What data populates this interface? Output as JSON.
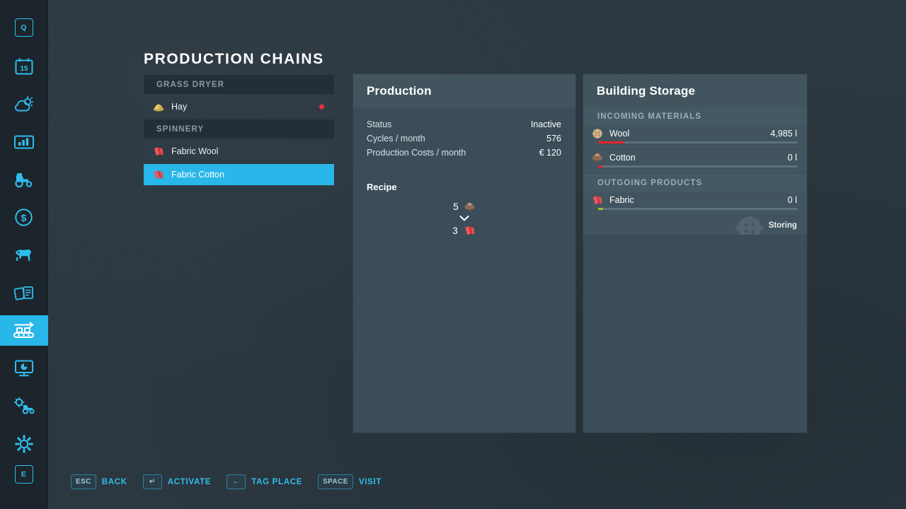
{
  "sidebar": {
    "items": [
      {
        "name": "sidebar-item-quick-menu",
        "icon": "key-q-icon",
        "key": "Q",
        "active": false
      },
      {
        "name": "sidebar-item-calendar",
        "icon": "calendar-15-icon",
        "key": "15",
        "active": false
      },
      {
        "name": "sidebar-item-weather",
        "icon": "weather-icon",
        "active": false
      },
      {
        "name": "sidebar-item-statistics",
        "icon": "chart-bar-icon",
        "active": false
      },
      {
        "name": "sidebar-item-vehicles",
        "icon": "tractor-icon",
        "active": false
      },
      {
        "name": "sidebar-item-finances",
        "icon": "dollar-circle-icon",
        "active": false
      },
      {
        "name": "sidebar-item-animals",
        "icon": "cow-icon",
        "active": false
      },
      {
        "name": "sidebar-item-contracts",
        "icon": "documents-icon",
        "active": false
      },
      {
        "name": "sidebar-item-production",
        "icon": "conveyor-belt-icon",
        "active": true
      },
      {
        "name": "sidebar-item-map-overview",
        "icon": "presentation-board-icon",
        "active": false
      },
      {
        "name": "sidebar-item-vehicle-config",
        "icon": "tractor-gear-icon",
        "active": false
      },
      {
        "name": "sidebar-item-settings",
        "icon": "gear-icon",
        "active": false
      },
      {
        "name": "sidebar-item-exit",
        "icon": "key-e-icon",
        "key": "E",
        "active": false
      }
    ]
  },
  "page_title": "PRODUCTION CHAINS",
  "chain_list": [
    {
      "type": "group",
      "label": "GRASS DRYER",
      "rows": [
        {
          "label": "Hay",
          "icon": "hay-pile-icon",
          "selected": false,
          "status_dot": "#e8323c"
        }
      ]
    },
    {
      "type": "group",
      "label": "SPINNERY",
      "rows": [
        {
          "label": "Fabric Wool",
          "icon": "fabric-bale-icon",
          "selected": false,
          "status_dot": null
        },
        {
          "label": "Fabric Cotton",
          "icon": "fabric-bale-icon",
          "selected": true,
          "status_dot": null
        }
      ]
    }
  ],
  "production": {
    "title": "Production",
    "stats": [
      {
        "label": "Status",
        "value": "Inactive"
      },
      {
        "label": "Cycles / month",
        "value": "576"
      },
      {
        "label": "Production Costs / month",
        "value": "€ 120"
      }
    ],
    "recipe_title": "Recipe",
    "recipe": {
      "input": {
        "amount": "5",
        "icon": "cotton-boll-icon"
      },
      "arrow": "chevron-down-icon",
      "output": {
        "amount": "3",
        "icon": "fabric-bale-icon"
      }
    }
  },
  "storage": {
    "title": "Building Storage",
    "sections": [
      {
        "label": "INCOMING MATERIALS",
        "items": [
          {
            "name": "Wool",
            "icon": "wool-ball-icon",
            "amount": "4,985 l",
            "fill_percent": 13,
            "fill_color": "#e8232d",
            "extra": null
          },
          {
            "name": "Cotton",
            "icon": "cotton-boll-icon",
            "amount": "0 l",
            "fill_percent": 2,
            "fill_color": "#e8232d",
            "extra": null
          }
        ]
      },
      {
        "label": "OUTGOING PRODUCTS",
        "items": [
          {
            "name": "Fabric",
            "icon": "fabric-bale-icon",
            "amount": "0 l",
            "fill_percent": 2,
            "fill_color": "#9ac42a",
            "extra": "Storing"
          }
        ]
      }
    ]
  },
  "help_bar": [
    {
      "key": "ESC",
      "label": "BACK"
    },
    {
      "key": "↵",
      "label": "ACTIVATE"
    },
    {
      "key": "←",
      "label": "TAG PLACE"
    },
    {
      "key": "SPACE",
      "label": "VISIT"
    }
  ],
  "colors": {
    "accent": "#29b6e8",
    "background": "#2b3740",
    "panel": "#3a4d58",
    "panel_header": "#42555f",
    "status_red": "#e8323c",
    "status_green": "#9ac42a"
  }
}
